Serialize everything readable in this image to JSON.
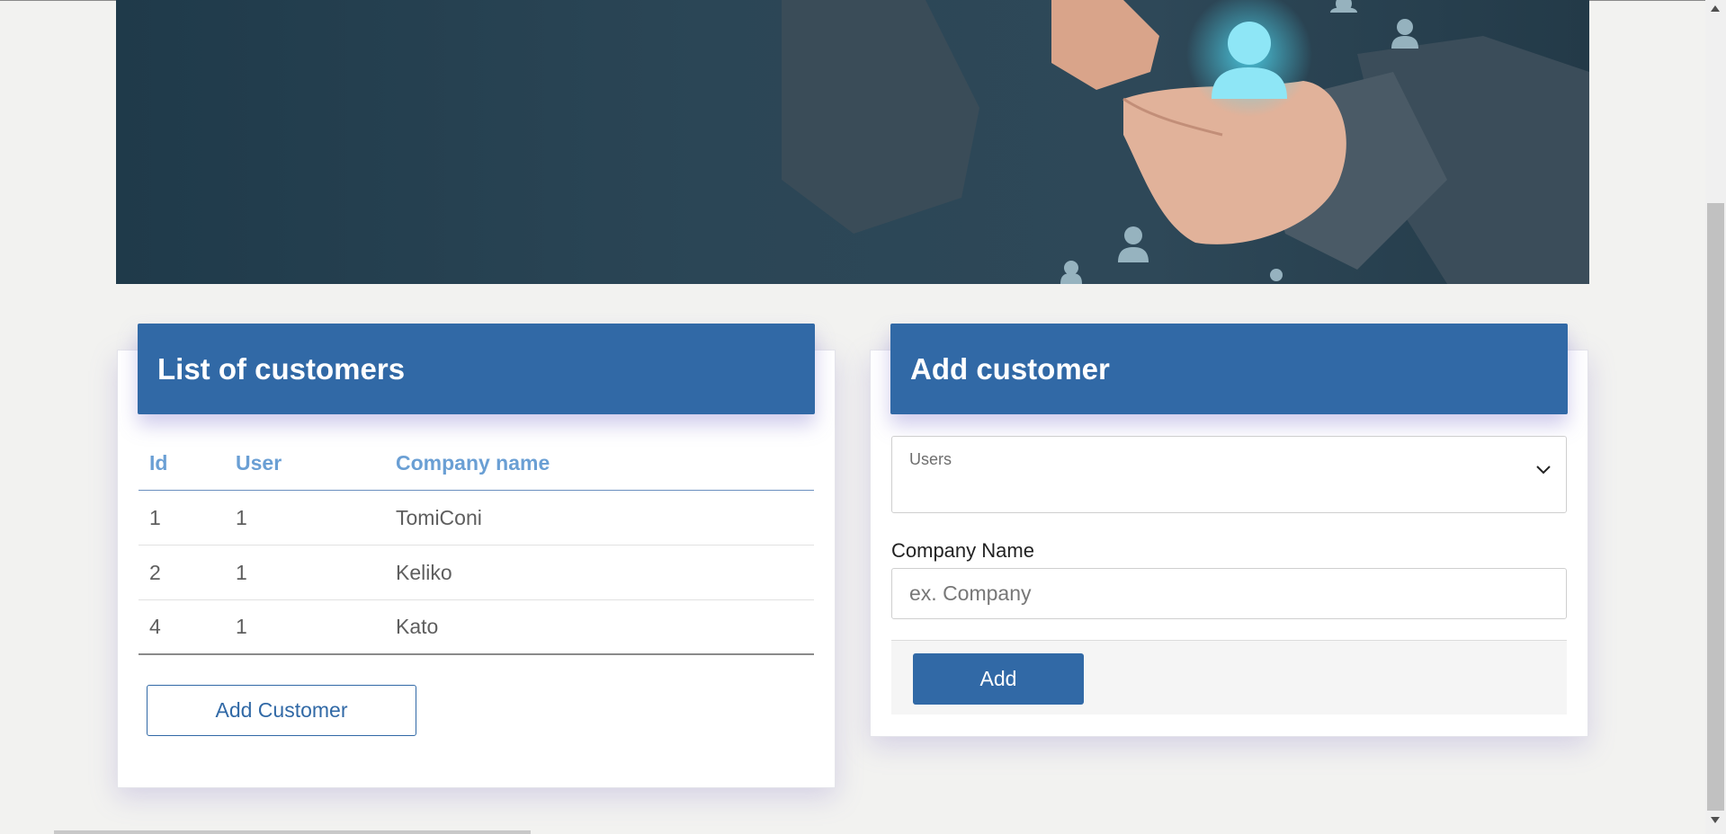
{
  "banner": {
    "image": "customer-care-hands-banner"
  },
  "customer_list": {
    "title": "List of customers",
    "columns": [
      "Id",
      "User",
      "Company name"
    ],
    "rows": [
      {
        "id": "1",
        "user": "1",
        "company": "TomiConi"
      },
      {
        "id": "2",
        "user": "1",
        "company": "Keliko"
      },
      {
        "id": "4",
        "user": "1",
        "company": "Kato"
      }
    ],
    "add_button_label": "Add Customer"
  },
  "add_customer": {
    "title": "Add customer",
    "users_select_label": "Users",
    "company_name_label": "Company Name",
    "company_name_placeholder": "ex. Company",
    "company_name_value": "",
    "submit_label": "Add"
  },
  "colors": {
    "primary": "#3169a6",
    "header_text": "#6a9fd4",
    "background": "#f2f2f0"
  }
}
